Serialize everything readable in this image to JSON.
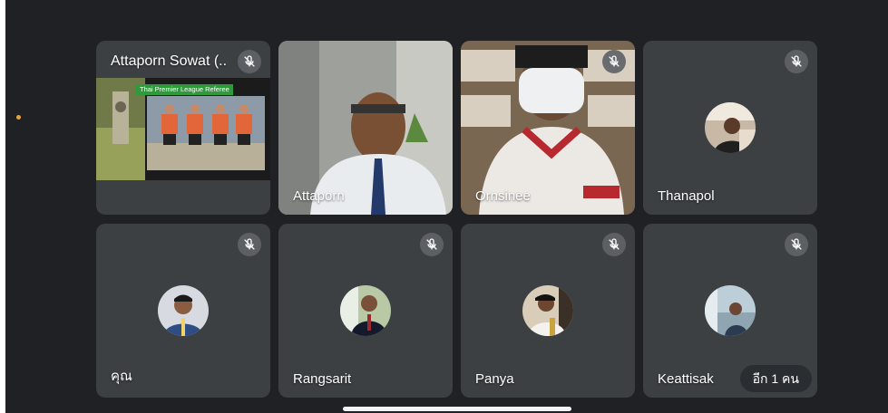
{
  "app": "Google Meet",
  "participants": [
    {
      "id": "p1",
      "name": "Attaporn Sowat (..",
      "muted": true,
      "view": "presentation"
    },
    {
      "id": "p2",
      "name": "Attaporn",
      "muted": false,
      "view": "video"
    },
    {
      "id": "p3",
      "name": "Ornsinee",
      "muted": true,
      "view": "video"
    },
    {
      "id": "p4",
      "name": "Thanapol",
      "muted": true,
      "view": "avatar"
    },
    {
      "id": "p5",
      "name": "คุณ",
      "muted": true,
      "view": "avatar"
    },
    {
      "id": "p6",
      "name": "Rangsarit",
      "muted": true,
      "view": "avatar"
    },
    {
      "id": "p7",
      "name": "Panya",
      "muted": true,
      "view": "avatar"
    },
    {
      "id": "p8",
      "name": "Keattisak",
      "muted": true,
      "view": "avatar"
    }
  ],
  "presentation": {
    "banner": "Thai Premier League Referee"
  },
  "more_participants": "อีก 1 คน",
  "icons": {
    "mic_off": "mic-off-icon"
  },
  "colors": {
    "tile": "#3c4043",
    "background": "#202124",
    "banner": "#2f9a3c"
  }
}
